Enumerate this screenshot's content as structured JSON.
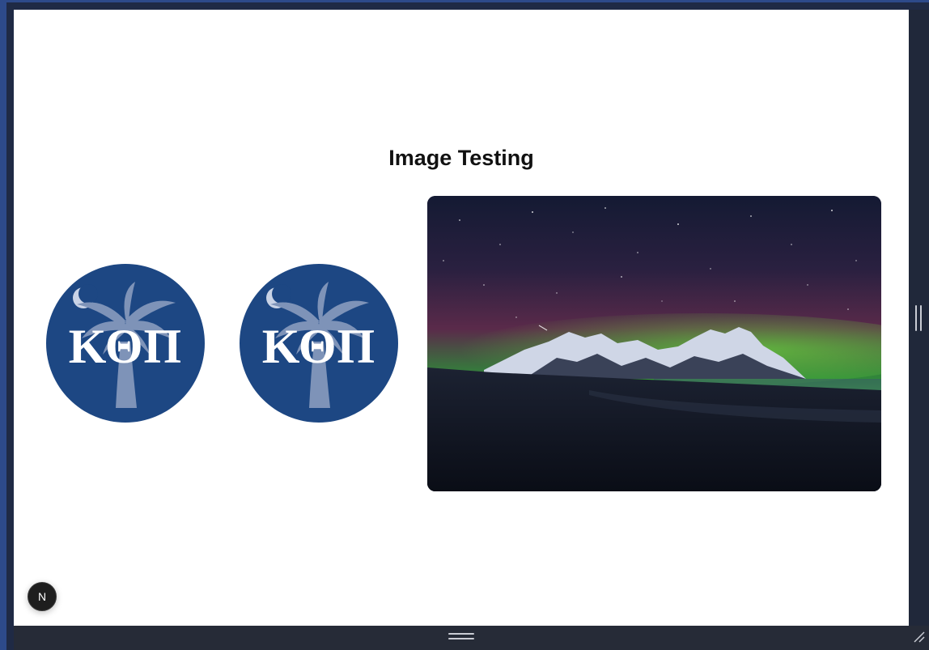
{
  "page": {
    "title": "Image Testing"
  },
  "images": {
    "logo_1": {
      "text": "ΚΘΠ",
      "icon": "palmetto-crescent-logo"
    },
    "logo_2": {
      "text": "ΚΘΠ",
      "icon": "palmetto-crescent-logo"
    },
    "landscape": {
      "icon": "aurora-mountain-photo"
    }
  },
  "dev_badge": {
    "label": "N"
  },
  "colors": {
    "logo_blue": "#1d4783",
    "palm_blue": "#7e93b8",
    "frame_blue": "#2d4a8a",
    "page_bg": "#ffffff"
  }
}
